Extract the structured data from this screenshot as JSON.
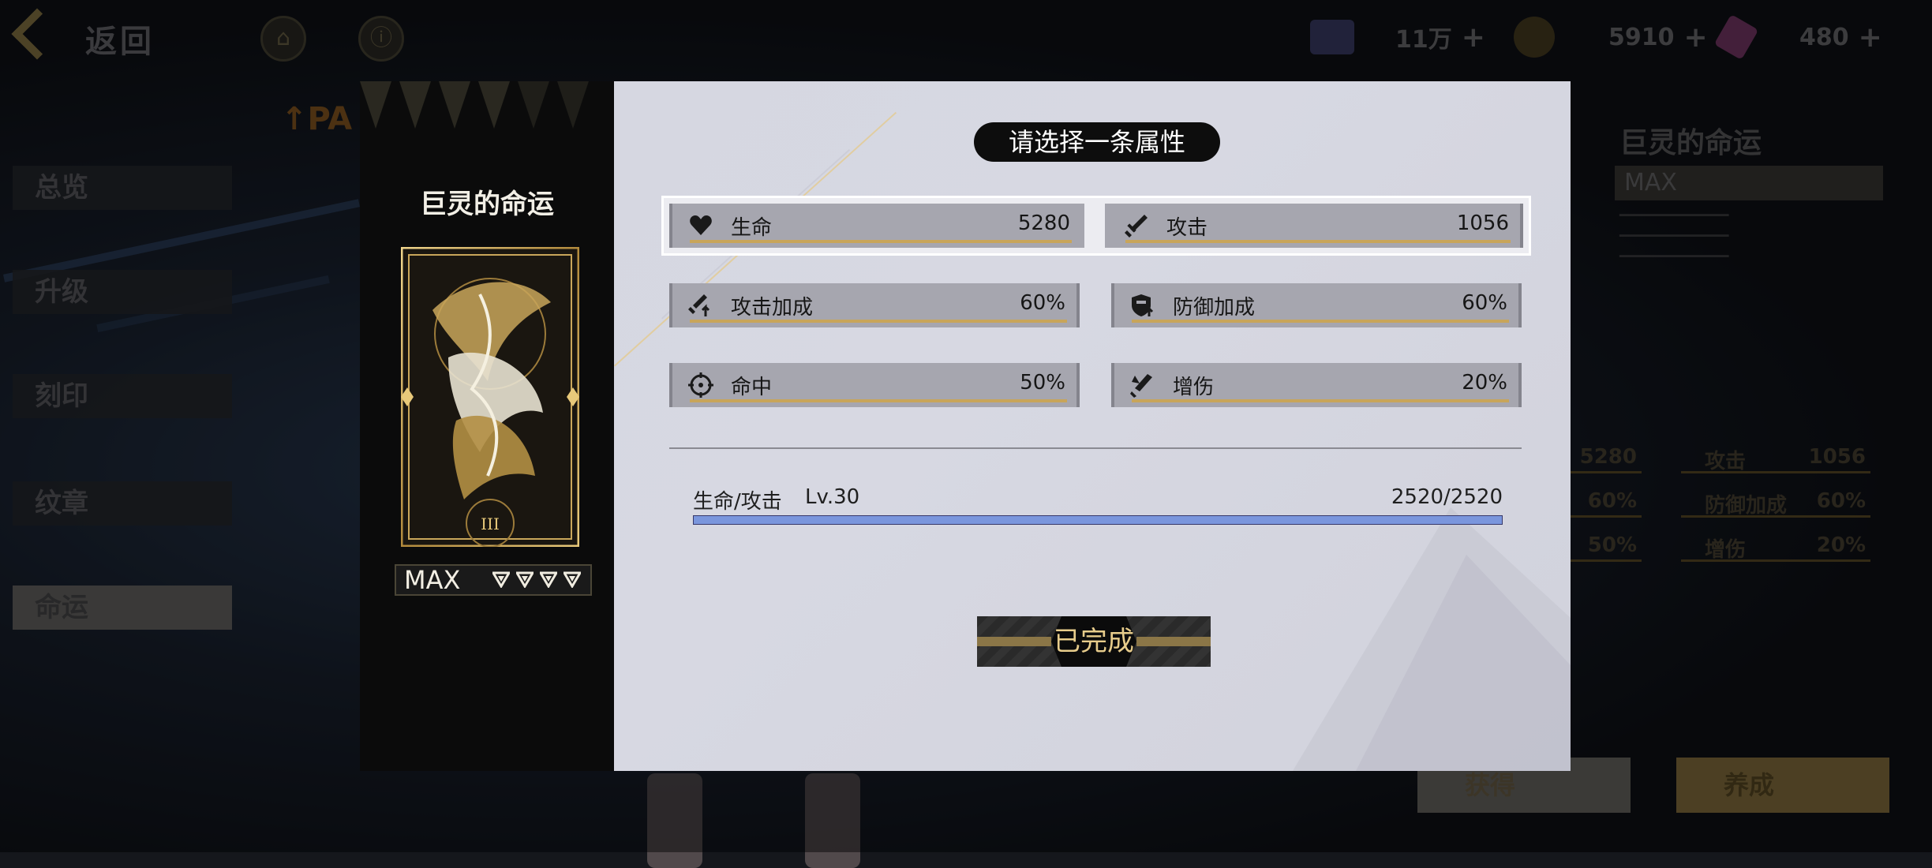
{
  "background": {
    "back_label": "返回",
    "resources": [
      {
        "name": "resource-1",
        "value": "11万"
      },
      {
        "name": "resource-2",
        "value": "5910"
      },
      {
        "name": "resource-3",
        "value": "480"
      }
    ],
    "side_menu": [
      "总览",
      "升级",
      "刻印",
      "纹章",
      "命运"
    ],
    "right_panel": {
      "title": "巨灵的命运",
      "level": "MAX",
      "stats": [
        {
          "value": "5280"
        },
        {
          "label": "攻击",
          "value": "1056"
        },
        {
          "value": "60%"
        },
        {
          "label": "防御加成",
          "value": "60%"
        },
        {
          "value": "50%"
        },
        {
          "label": "增伤",
          "value": "20%"
        }
      ],
      "buttons": [
        "获得",
        "养成"
      ]
    }
  },
  "modal": {
    "card": {
      "name": "巨灵的命运",
      "level_label": "MAX",
      "pip_count": 4,
      "numeral": "III"
    },
    "prompt": "请选择一条属性",
    "attributes": [
      {
        "id": "hp",
        "icon": "heart-icon",
        "label": "生命",
        "value": "5280",
        "selected": true
      },
      {
        "id": "atk",
        "icon": "sword-icon",
        "label": "攻击",
        "value": "1056",
        "selected": true
      },
      {
        "id": "atk_bonus",
        "icon": "sword-up-icon",
        "label": "攻击加成",
        "value": "60%"
      },
      {
        "id": "def_bonus",
        "icon": "shield-icon",
        "label": "防御加成",
        "value": "60%"
      },
      {
        "id": "hit",
        "icon": "crosshair-icon",
        "label": "命中",
        "value": "50%"
      },
      {
        "id": "dmg_up",
        "icon": "dmg-up-icon",
        "label": "增伤",
        "value": "20%"
      }
    ],
    "progress": {
      "label": "生命/攻击",
      "level": "Lv.30",
      "count": "2520/2520",
      "fraction": 1.0
    },
    "done_button": "已完成",
    "colors": {
      "accent_gold": "#c8a55a",
      "progress_blue": "#7a96dd",
      "panel_bg": "#d6d7e1"
    }
  }
}
